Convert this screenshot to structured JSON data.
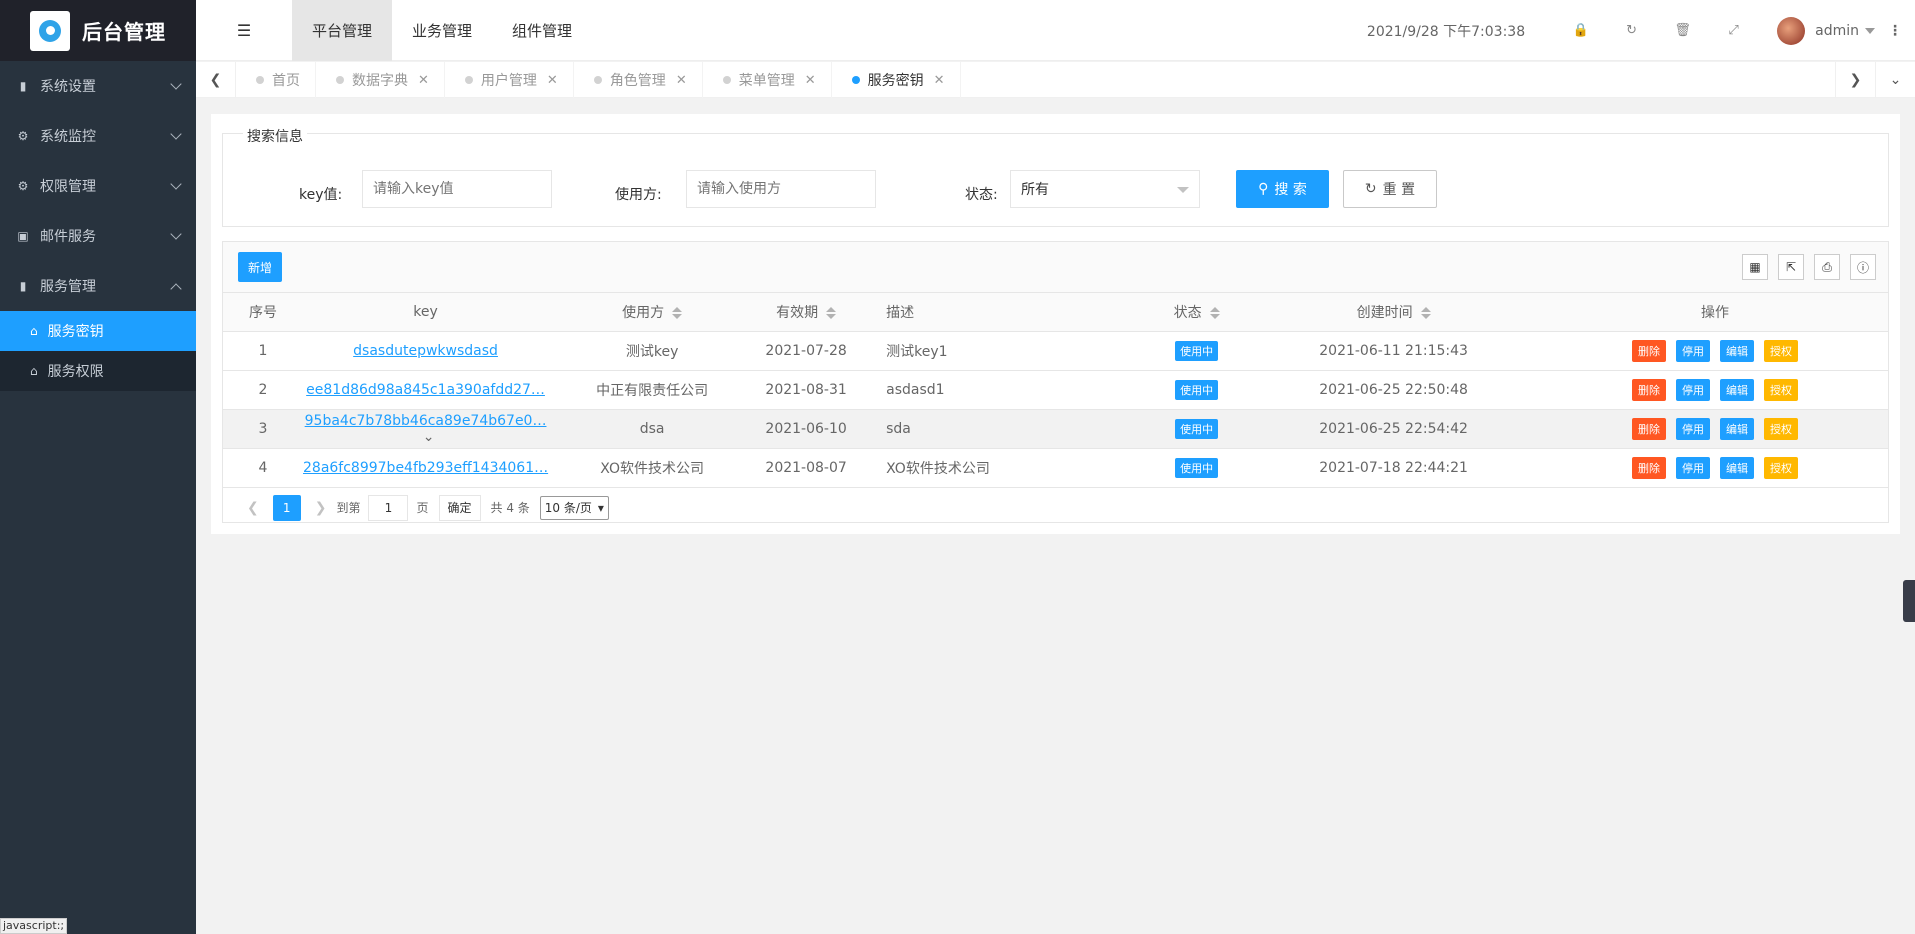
{
  "app": {
    "title": "后台管理"
  },
  "sidebar": {
    "items": [
      {
        "label": "系统设置",
        "icon": "bookmark-icon",
        "expanded": false
      },
      {
        "label": "系统监控",
        "icon": "gears-icon",
        "expanded": false
      },
      {
        "label": "权限管理",
        "icon": "gears-icon",
        "expanded": false
      },
      {
        "label": "邮件服务",
        "icon": "contact-icon",
        "expanded": false
      },
      {
        "label": "服务管理",
        "icon": "bookmark-icon",
        "expanded": true
      }
    ],
    "subitems": [
      {
        "label": "服务密钥",
        "icon": "home-icon",
        "active": true
      },
      {
        "label": "服务权限",
        "icon": "home-icon",
        "active": false
      }
    ]
  },
  "header": {
    "tabs": [
      {
        "label": "平台管理",
        "active": true
      },
      {
        "label": "业务管理",
        "active": false
      },
      {
        "label": "组件管理",
        "active": false
      }
    ],
    "datetime": "2021/9/28 下午7:03:38",
    "user": "admin"
  },
  "tabbar": {
    "tabs": [
      {
        "label": "首页",
        "closable": false,
        "active": false
      },
      {
        "label": "数据字典",
        "closable": true,
        "active": false
      },
      {
        "label": "用户管理",
        "closable": true,
        "active": false
      },
      {
        "label": "角色管理",
        "closable": true,
        "active": false
      },
      {
        "label": "菜单管理",
        "closable": true,
        "active": false
      },
      {
        "label": "服务密钥",
        "closable": true,
        "active": true
      }
    ]
  },
  "search": {
    "legend": "搜索信息",
    "key_label": "key值:",
    "key_placeholder": "请输入key值",
    "user_label": "使用方:",
    "user_placeholder": "请输入使用方",
    "status_label": "状态:",
    "status_value": "所有",
    "search_button": "搜 索",
    "reset_button": "重 置"
  },
  "table": {
    "add_button": "新增",
    "columns": [
      "序号",
      "key",
      "使用方",
      "有效期",
      "描述",
      "状态",
      "创建时间",
      "操作"
    ],
    "rows": [
      {
        "no": "1",
        "key": "dsasdutepwkwsdasd",
        "user": "测试key",
        "expire": "2021-07-28",
        "desc": "测试key1",
        "status": "使用中",
        "created": "2021-06-11 21:15:43"
      },
      {
        "no": "2",
        "key": "ee81d86d98a845c1a390afdd27…",
        "user": "中正有限责任公司",
        "expire": "2021-08-31",
        "desc": "asdasd1",
        "status": "使用中",
        "created": "2021-06-25 22:50:48"
      },
      {
        "no": "3",
        "key": "95ba4c7b78bb46ca89e74b67e0…",
        "user": "dsa",
        "expire": "2021-06-10",
        "desc": "sda",
        "status": "使用中",
        "created": "2021-06-25 22:54:42"
      },
      {
        "no": "4",
        "key": "28a6fc8997be4fb293eff1434061…",
        "user": "XO软件技术公司",
        "expire": "2021-08-07",
        "desc": "XO软件技术公司",
        "status": "使用中",
        "created": "2021-07-18 22:44:21"
      }
    ],
    "ops": {
      "delete": "删除",
      "disable": "停用",
      "edit": "编辑",
      "authorize": "授权"
    }
  },
  "pager": {
    "current": "1",
    "goto_label": "到第",
    "goto_value": "1",
    "page_unit": "页",
    "confirm": "确定",
    "total": "共 4 条",
    "page_size": "10 条/页"
  },
  "statusbar": {
    "text": "javascript:;"
  }
}
